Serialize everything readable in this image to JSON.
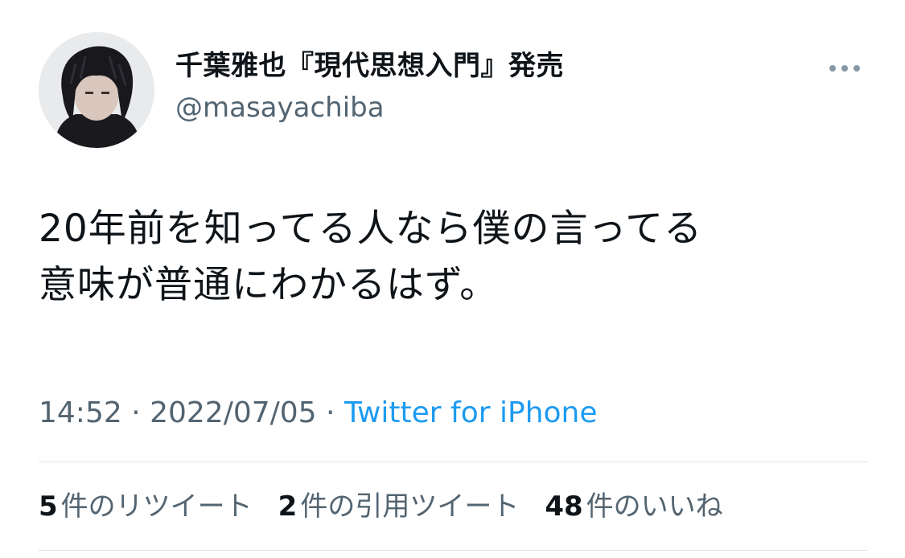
{
  "author": {
    "display_name": "千葉雅也『現代思想入門』発売",
    "handle": "@masayachiba"
  },
  "tweet": {
    "text_line1": "20年前を知ってる人なら僕の言ってる",
    "text_line2": "意味が普通にわかるはず。"
  },
  "meta": {
    "time": "14:52",
    "separator": " · ",
    "date": "2022/07/05",
    "source": "Twitter for iPhone"
  },
  "stats": {
    "retweets_count": "5",
    "retweets_label": "件のリツイート",
    "quotes_count": "2",
    "quotes_label": "件の引用ツイート",
    "likes_count": "48",
    "likes_label": "件のいいね"
  },
  "icons": {
    "more": "more-horizontal-icon"
  },
  "colors": {
    "link": "#1d9bf0",
    "secondary_text": "#536471",
    "primary_text": "#0f1419",
    "divider": "#dfe3e6"
  }
}
